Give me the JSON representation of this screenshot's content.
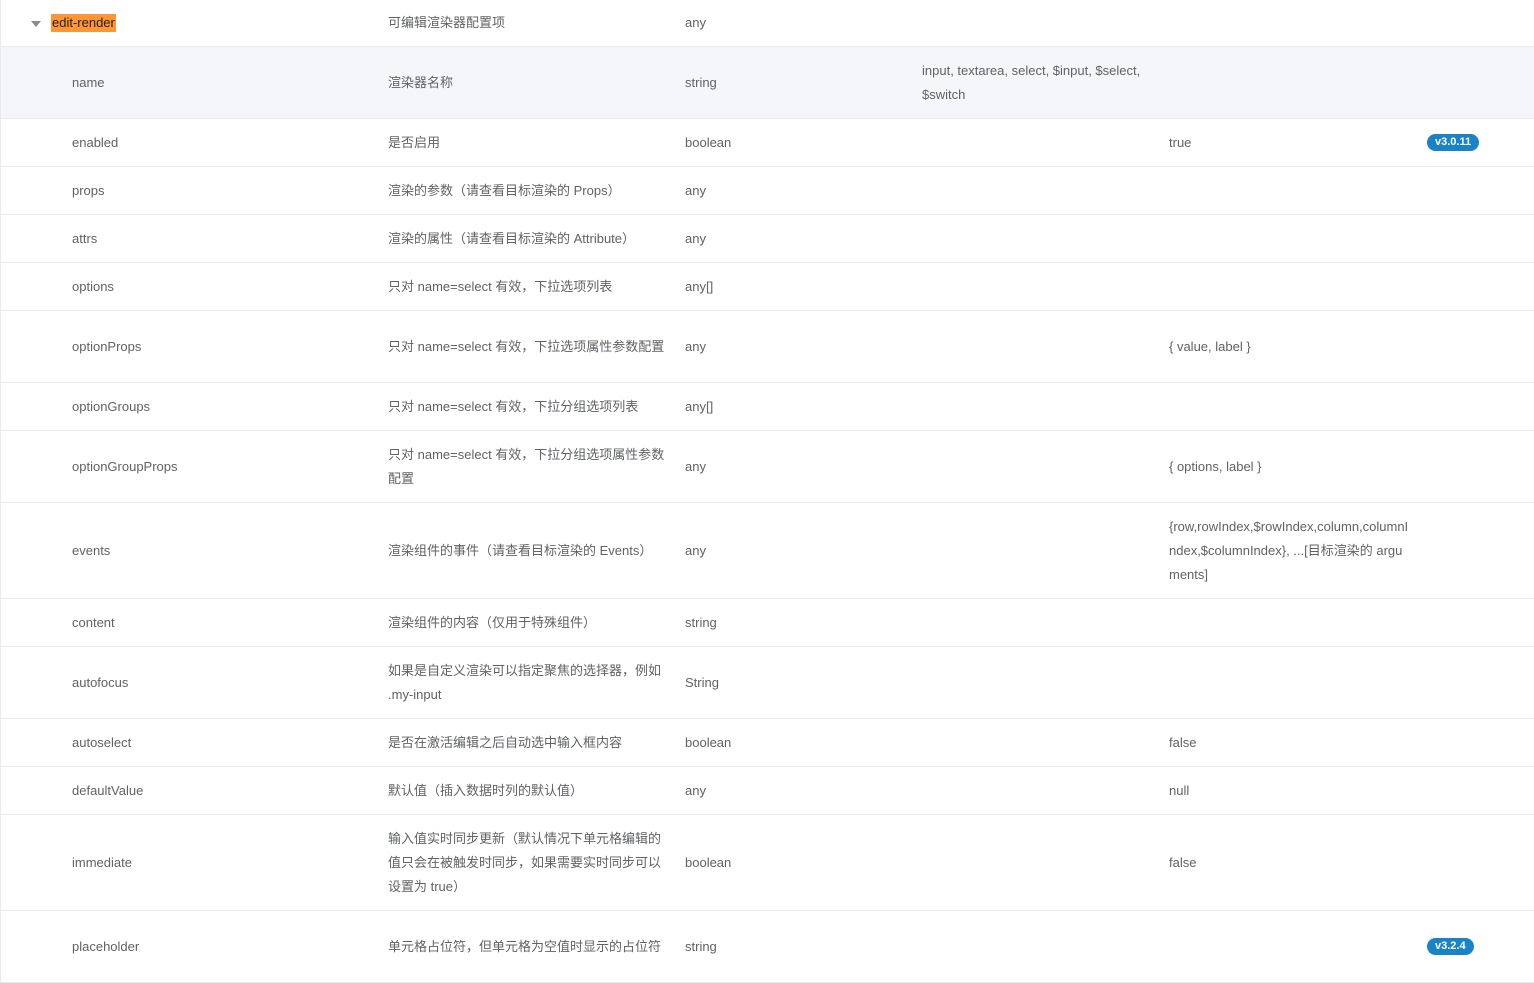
{
  "parent": {
    "name": "edit-render",
    "desc": "可编辑渲染器配置项",
    "type": "any"
  },
  "rows": [
    {
      "name": "name",
      "desc": "渲染器名称",
      "type": "string",
      "enum": "input, textarea, select, $input, $select, $switch",
      "default": "",
      "version": ""
    },
    {
      "name": "enabled",
      "desc": "是否启用",
      "type": "boolean",
      "enum": "",
      "default": "true",
      "version": "v3.0.11"
    },
    {
      "name": "props",
      "desc": "渲染的参数（请查看目标渲染的 Props）",
      "type": "any",
      "enum": "",
      "default": "",
      "version": ""
    },
    {
      "name": "attrs",
      "desc": "渲染的属性（请查看目标渲染的 Attribute）",
      "type": "any",
      "enum": "",
      "default": "",
      "version": ""
    },
    {
      "name": "options",
      "desc": "只对 name=select 有效，下拉选项列表",
      "type": "any[]",
      "enum": "",
      "default": "",
      "version": ""
    },
    {
      "name": "optionProps",
      "desc": "只对 name=select 有效，下拉选项属性参数配置",
      "type": "any",
      "enum": "",
      "default": "{ value, label }",
      "version": ""
    },
    {
      "name": "optionGroups",
      "desc": "只对 name=select 有效，下拉分组选项列表",
      "type": "any[]",
      "enum": "",
      "default": "",
      "version": ""
    },
    {
      "name": "optionGroupProps",
      "desc": "只对 name=select 有效，下拉分组选项属性参数配置",
      "type": "any",
      "enum": "",
      "default": "{ options, label }",
      "version": ""
    },
    {
      "name": "events",
      "desc": "渲染组件的事件（请查看目标渲染的 Events）",
      "type": "any",
      "enum": "",
      "default": "{row,rowIndex,$rowIndex,column,columnIndex,$columnIndex}, ...[目标渲染的 arguments]",
      "version": ""
    },
    {
      "name": "content",
      "desc": "渲染组件的内容（仅用于特殊组件）",
      "type": "string",
      "enum": "",
      "default": "",
      "version": ""
    },
    {
      "name": "autofocus",
      "desc": "如果是自定义渲染可以指定聚焦的选择器，例如 .my-input",
      "type": "String",
      "enum": "",
      "default": "",
      "version": ""
    },
    {
      "name": "autoselect",
      "desc": "是否在激活编辑之后自动选中输入框内容",
      "type": "boolean",
      "enum": "",
      "default": "false",
      "version": ""
    },
    {
      "name": "defaultValue",
      "desc": "默认值（插入数据时列的默认值）",
      "type": "any",
      "enum": "",
      "default": "null",
      "version": ""
    },
    {
      "name": "immediate",
      "desc": "输入值实时同步更新（默认情况下单元格编辑的值只会在被触发时同步，如果需要实时同步可以设置为 true）",
      "type": "boolean",
      "enum": "",
      "default": "false",
      "version": ""
    },
    {
      "name": "placeholder",
      "desc": "单元格占位符，但单元格为空值时显示的占位符",
      "type": "string",
      "enum": "",
      "default": "",
      "version": "v3.2.4"
    }
  ]
}
